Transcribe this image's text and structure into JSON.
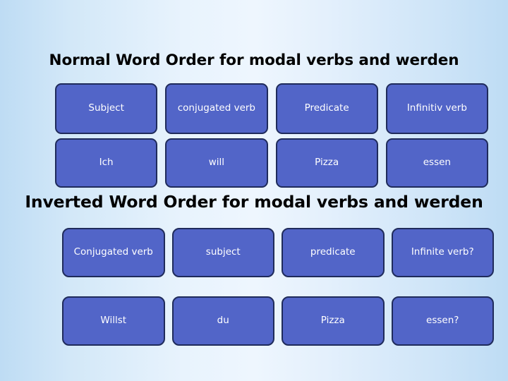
{
  "slide": {
    "sections": [
      {
        "id": "normal",
        "heading": "Normal Word Order for modal verbs and werden",
        "rows": [
          [
            "Subject",
            "conjugated verb",
            "Predicate",
            "Infinitiv verb"
          ],
          [
            "Ich",
            "will",
            "Pizza",
            "essen"
          ]
        ]
      },
      {
        "id": "inverted",
        "heading": "Inverted Word Order for modal verbs and werden",
        "rows": [
          [
            "Conjugated verb",
            "subject",
            "predicate",
            "Infinite verb?"
          ],
          [
            "Willst",
            "du",
            "Pizza",
            "essen?"
          ]
        ]
      }
    ]
  },
  "colors": {
    "cell_fill": "#5265c8",
    "cell_border": "#1f2b5b",
    "cell_text": "#ffffff",
    "heading_text": "#000000",
    "background_edge": "#bedcf4",
    "background_center": "#eef6fe"
  }
}
